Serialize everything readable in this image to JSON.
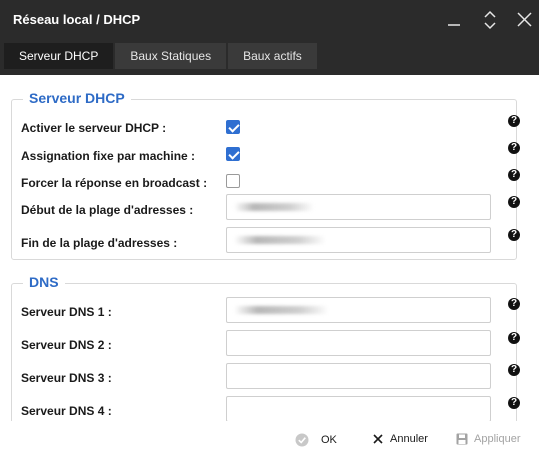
{
  "window": {
    "title": "Réseau local / DHCP"
  },
  "tabs": [
    {
      "label": "Serveur DHCP",
      "active": true
    },
    {
      "label": "Baux Statiques",
      "active": false
    },
    {
      "label": "Baux actifs",
      "active": false
    }
  ],
  "dhcp": {
    "legend": "Serveur DHCP",
    "fields": [
      {
        "label": "Activer le serveur DHCP :",
        "type": "checkbox",
        "checked": true
      },
      {
        "label": "Assignation fixe par machine :",
        "type": "checkbox",
        "checked": true
      },
      {
        "label": "Forcer la réponse en broadcast :",
        "type": "checkbox",
        "checked": false
      },
      {
        "label": "Début de la plage d'adresses :",
        "type": "text",
        "value": ""
      },
      {
        "label": "Fin de la plage d'adresses :",
        "type": "text",
        "value": ""
      }
    ]
  },
  "dns": {
    "legend": "DNS",
    "fields": [
      {
        "label": "Serveur DNS 1 :",
        "value": ""
      },
      {
        "label": "Serveur DNS 2 :",
        "value": ""
      },
      {
        "label": "Serveur DNS 3 :",
        "value": ""
      },
      {
        "label": "Serveur DNS 4 :",
        "value": ""
      }
    ]
  },
  "help_glyph": "?",
  "footer": {
    "ok_label": "OK",
    "cancel_label": "Annuler",
    "apply_label": "Appliquer"
  },
  "colors": {
    "titlebar": "#2b2b2b",
    "accent": "#2e6bc6",
    "checkbox": "#2f6fd1"
  }
}
